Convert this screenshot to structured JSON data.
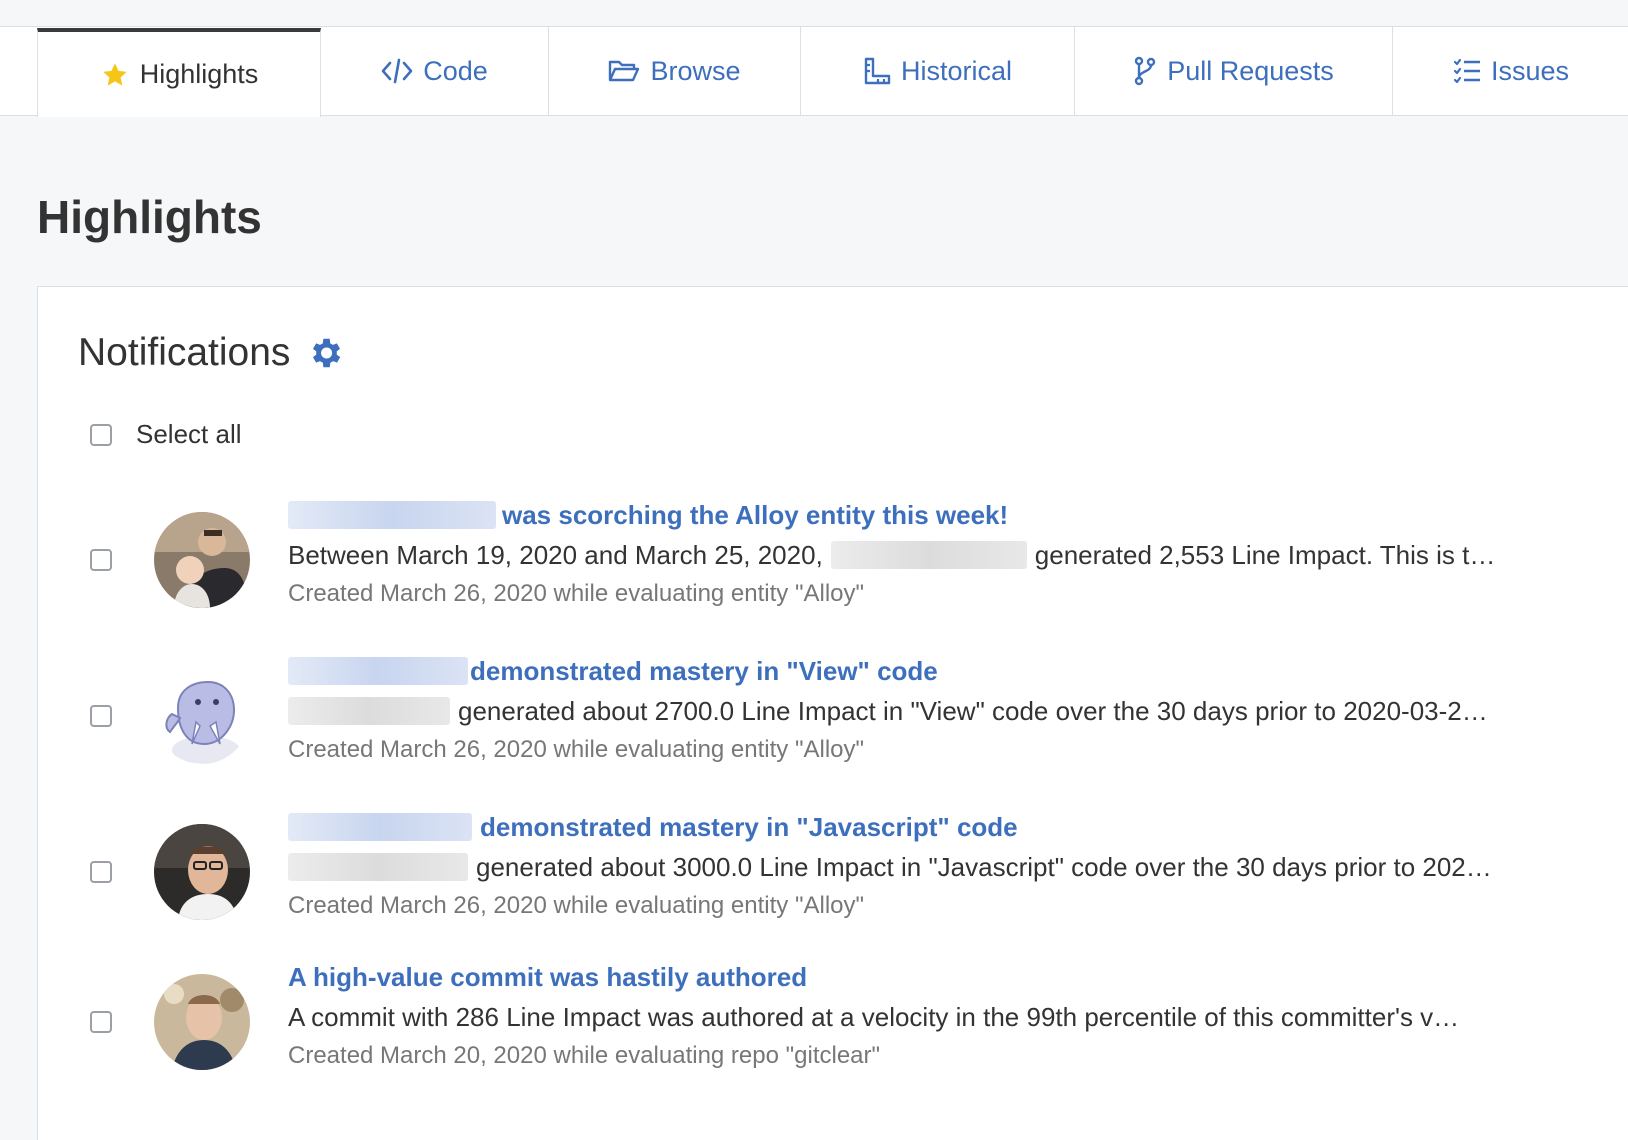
{
  "tabs": [
    {
      "label": "Highlights",
      "icon": "star-icon",
      "active": true
    },
    {
      "label": "Code",
      "icon": "code-icon",
      "active": false
    },
    {
      "label": "Browse",
      "icon": "folder-open-icon",
      "active": false
    },
    {
      "label": "Historical",
      "icon": "ruler-icon",
      "active": false
    },
    {
      "label": "Pull Requests",
      "icon": "git-branch-icon",
      "active": false
    },
    {
      "label": "Issues",
      "icon": "list-check-icon",
      "active": false
    }
  ],
  "page": {
    "title": "Highlights"
  },
  "card": {
    "title": "Notifications",
    "select_all": "Select all"
  },
  "notifications": [
    {
      "title": "was scorching the Alloy entity this week!",
      "body_prefix": "Between March 19, 2020 and March 25, 2020,",
      "body_rest": "generated 2,553 Line Impact. This is t…",
      "meta": "Created March 26, 2020 while evaluating entity \"Alloy\""
    },
    {
      "title": "demonstrated mastery in \"View\" code",
      "body_prefix": "",
      "body_rest": "generated about 2700.0 Line Impact in \"View\" code over the 30 days prior to 2020-03-2…",
      "meta": "Created March 26, 2020 while evaluating entity \"Alloy\""
    },
    {
      "title": "demonstrated mastery in \"Javascript\" code",
      "body_prefix": "",
      "body_rest": "generated about 3000.0 Line Impact in \"Javascript\" code over the 30 days prior to 202…",
      "meta": "Created March 26, 2020 while evaluating entity \"Alloy\""
    },
    {
      "title": "A high-value commit was hastily authored",
      "body_prefix": "",
      "body_rest": "A commit with 286 Line Impact was authored at a velocity in the 99th percentile of this committer's v…",
      "meta": "Created March 20, 2020 while evaluating repo \"gitclear\""
    }
  ],
  "colors": {
    "accent": "#3d6fbd",
    "star": "#f5c518",
    "text": "#333333",
    "muted": "#777777",
    "background": "#f6f7f8"
  }
}
